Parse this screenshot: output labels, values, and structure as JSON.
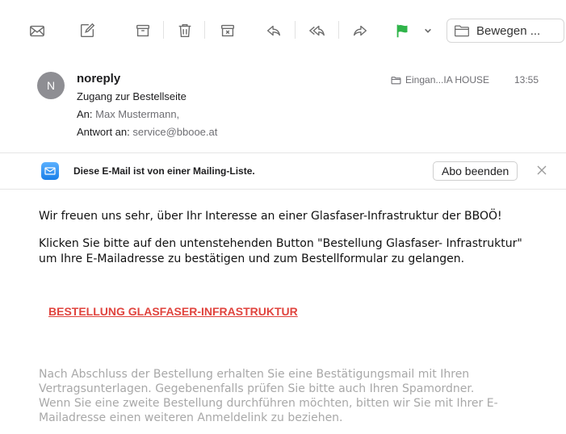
{
  "toolbar": {
    "move_label": "Bewegen ..."
  },
  "message": {
    "avatar_initial": "N",
    "sender": "noreply",
    "subject": "Zugang zur Bestellseite",
    "to_label": "An:",
    "to_value": "Max Mustermann,",
    "reply_label": "Antwort an:",
    "reply_value": "service@bbooe.at",
    "mailbox": "Eingan...IA HOUSE",
    "time": "13:55"
  },
  "mailing_list": {
    "notice": "Diese E-Mail ist von einer Mailing-Liste.",
    "unsubscribe_label": "Abo beenden"
  },
  "content": {
    "paragraph1": "Wir freuen uns sehr, über Ihr Interesse an einer Glasfaser-Infrastruktur der BBOÖ!",
    "paragraph2_line1": "Klicken Sie bitte auf den untenstehenden Button \"Bestellung Glasfaser- Infrastruktur\"",
    "paragraph2_line2": "um Ihre E-Mailadresse zu bestätigen und zum Bestellformular zu gelangen.",
    "order_link": "BESTELLUNG GLASFASER-INFRASTRUKTUR",
    "faded_line1": "Nach Abschluss der Bestellung erhalten Sie eine Bestätigungsmail mit Ihren",
    "faded_line2": "Vertragsunterlagen. Gegebenenfalls prüfen Sie bitte auch Ihren Spamordner.",
    "faded_line3": "Wenn Sie eine zweite Bestellung durchführen möchten, bitten wir Sie mit Ihrer E-",
    "faded_line4": "Mailadresse einen weiteren Anmeldelink zu beziehen."
  },
  "colors": {
    "flag": "#2fb44a",
    "link": "#e0443e",
    "accent": "#1a7fe8"
  }
}
